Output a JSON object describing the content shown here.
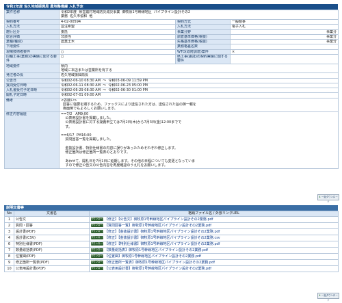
{
  "main_panel": {
    "title": "令和2年度  佐久地域振興局  農地整備課  入札予定",
    "rows": [
      {
        "key": "row-project-name",
        "label": "案件名称",
        "value": "令和2年度  県営農村地域防災減災事業  御牧原1号幹線地区  パイプライン設計その2\n業務  佐久市協和  他",
        "span": true,
        "h": 14
      },
      {
        "key": "row-contract-no",
        "label": "契約番号",
        "value": "4-02-00594",
        "label2": "契約方式",
        "value2": "一般競争"
      },
      {
        "key": "row-bid-method",
        "label": "入札方法",
        "value": "並注希望",
        "label2": "入札方法",
        "value2": "電子入札"
      },
      {
        "key": "row-executor",
        "label": "施行区分",
        "value": "委託",
        "label2": "事業分野",
        "value2": "",
        "note2": "事業分"
      },
      {
        "key": "row-general-class",
        "label": "総合評価",
        "value": "非該当",
        "label2": "調査基準価格(税抜)",
        "value2": "",
        "note2": "事業分"
      },
      {
        "key": "row-business-type",
        "label": "業種(種別)",
        "value": "農業土木",
        "label2": "失格基準価格(税抜)",
        "value2": "",
        "note2": "事業分"
      },
      {
        "key": "row-lower-limit",
        "label": "下限要件",
        "value": "",
        "label2": "業務格差名数",
        "value2": ""
      },
      {
        "key": "row-delegation",
        "label": "現場技術者要件",
        "value": "○",
        "label2": "WTO(政府調達)案件",
        "value2": "×"
      },
      {
        "key": "row-cooperation",
        "label": "同種工事(業務)の実績に関する要件",
        "value": "○",
        "label2": "県工事(委託)の契約実績に関する要件",
        "value2": "",
        "h": 12
      },
      {
        "key": "row-region",
        "label": "地域要件",
        "value": "県内\n地域に本店または営業所を有する",
        "span": true,
        "h": 12
      },
      {
        "key": "row-orderer",
        "label": "発注者の長",
        "value": "佐久地域振興局長",
        "span": true
      },
      {
        "key": "row-announce-date",
        "label": "公告日",
        "value": "令和02-06-10 08:30 AM  〜  令和03-06-09 11:59 PM",
        "span": true
      },
      {
        "key": "row-inquiry-date",
        "label": "質問受付日時",
        "value": "令和02-06-11 08:30 AM  〜  令和02-06-23 05:00 PM",
        "span": true
      },
      {
        "key": "row-bid-date",
        "label": "入札書受付予定日時",
        "value": "令和02-06-29 08:30 AM  〜  令和02-06-30 01:00 PM",
        "span": true
      },
      {
        "key": "row-open-date",
        "label": "開札予定日時",
        "value": "令和02-07-01 09:00 AM",
        "span": true
      },
      {
        "key": "row-remarks",
        "label": "備考",
        "value": "<お願い>\n  回答に強要を期するため、ファックスにより送信された方は、送信された旨の御一報を\n  御面倒でもよろしくお願いします。",
        "span": true,
        "h": 19
      },
      {
        "key": "row-corrections",
        "label": "修正内容履歴",
        "value": "==7/2   AM9:00\n    公表用設計書を掲載しました。\n    公表用設計書に対する疑義申立ては7月2日(木)から7月3日(金)12:00までで\n    す。\n\n==6/17  PM16:00\n    質問回答一覧を掲載しました。\n\n    金抜設計書、特別仕様書の内容に誤りがあったためそれぞれ修正します。\n    修正箇所は修正箇所一覧表のとおりです。\n\n    あわせて、開札日を7月1日に延期します。その他の日程についても変更となっていま\n    すので修正公告文の公告内容を再度確認のうえ札をお願いします。",
        "span": true,
        "h": 80
      }
    ]
  },
  "docs_panel": {
    "title": "説明文書等",
    "download_all_label": "一括ダウンロード",
    "col_headers": [
      "No",
      "文書名",
      "格納ファイル名 / 外部リンクURL"
    ],
    "download_label": "ダウンロード",
    "items": [
      {
        "no": "1",
        "name": "公告文",
        "file": "【修正】【公告文】御牧原1号幹線地区パイプライン設計その2業務.pdf"
      },
      {
        "no": "2",
        "name": "質問・回答",
        "file": "【質問回答一覧】御牧原1号幹線地区パイプライン設計その2業務.pdf"
      },
      {
        "no": "3",
        "name": "設計書(PDF)",
        "file": "【修正】【金抜設計書】御牧原1号幹線地区パイプライン設計その2業務.pdf"
      },
      {
        "no": "4",
        "name": "設計書(CSV)",
        "file": "【修正】【金抜設計書】御牧原1号幹線地区パイプライン設計その2業務.csv"
      },
      {
        "no": "6",
        "name": "特別仕様書(PDF)",
        "file": "【修正】【特別仕様書】御牧原1号幹線地区パイプライン設計その2業務.pdf"
      },
      {
        "no": "7",
        "name": "数量総括表(PDF)",
        "file": "【数量総括表】御牧原1号幹線地区パイプライン設計その2業務.pdf"
      },
      {
        "no": "8",
        "name": "位置図(PDF)",
        "file": "【位置図】御牧原1号幹線地区パイプライン設計その2業務.pdf"
      },
      {
        "no": "9",
        "name": "修正箇所一覧表(PDF)",
        "file": "【修正箇所一覧表】御牧原1号幹線地区パイプライン設計その2業務.pdf"
      },
      {
        "no": "10",
        "name": "公表用設計書(PDF)",
        "file": "【公表用設計書】御牧原1号幹線地区パイプライン設計その2業務.pdf"
      }
    ]
  }
}
